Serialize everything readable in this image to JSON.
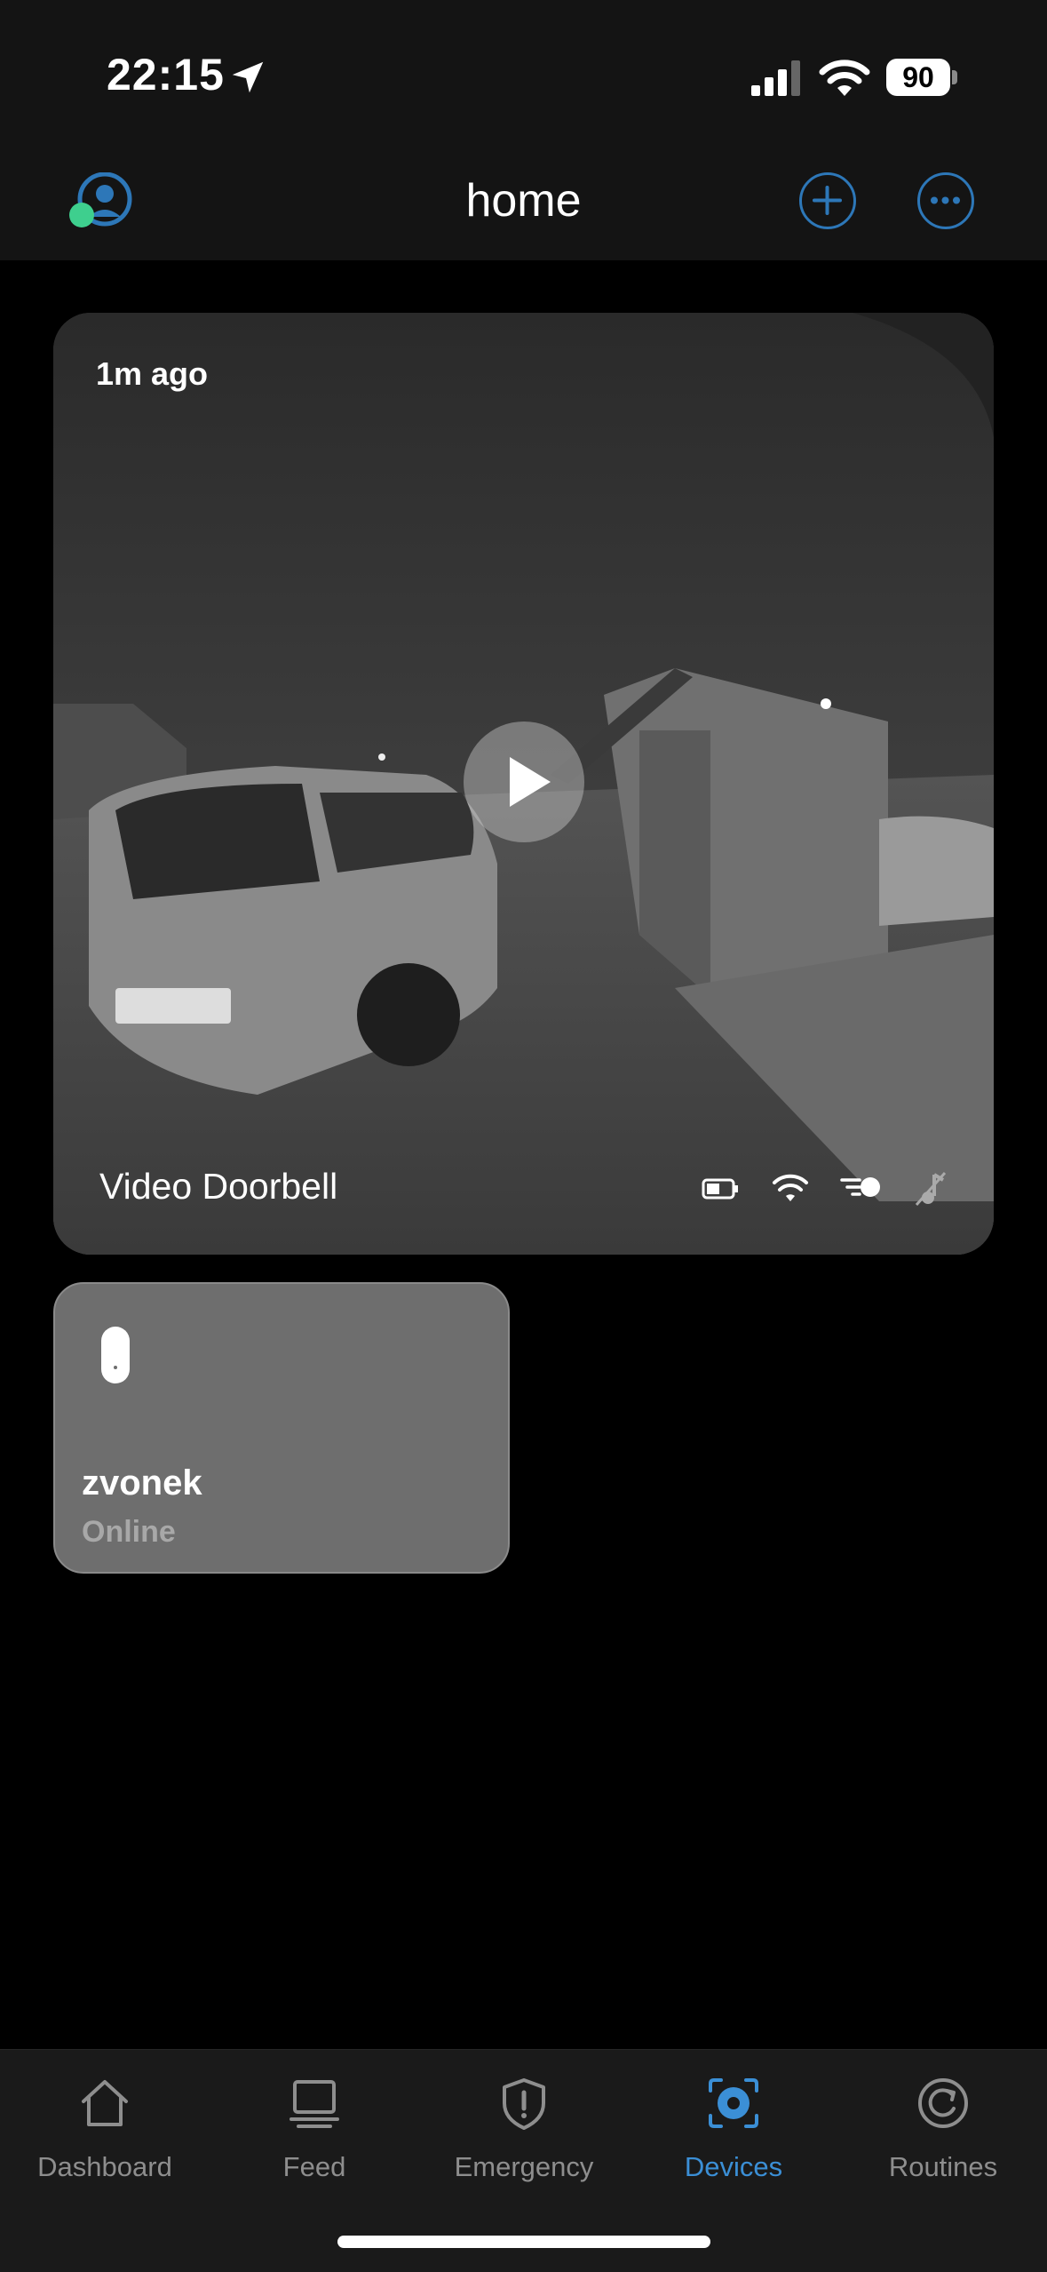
{
  "status_bar": {
    "time": "22:15",
    "battery": "90"
  },
  "header": {
    "title": "home"
  },
  "camera": {
    "time_ago": "1m ago",
    "name": "Video Doorbell"
  },
  "device": {
    "name": "zvonek",
    "status": "Online"
  },
  "tabs": [
    {
      "label": "Dashboard",
      "icon": "house-icon",
      "active": false
    },
    {
      "label": "Feed",
      "icon": "monitor-icon",
      "active": false
    },
    {
      "label": "Emergency",
      "icon": "shield-alert-icon",
      "active": false
    },
    {
      "label": "Devices",
      "icon": "camera-devices-icon",
      "active": true
    },
    {
      "label": "Routines",
      "icon": "routine-cycle-icon",
      "active": false
    }
  ],
  "colors": {
    "accent": "#3b8fd6",
    "button_outline": "#2d77b8",
    "online_dot": "#3ecf8e"
  }
}
